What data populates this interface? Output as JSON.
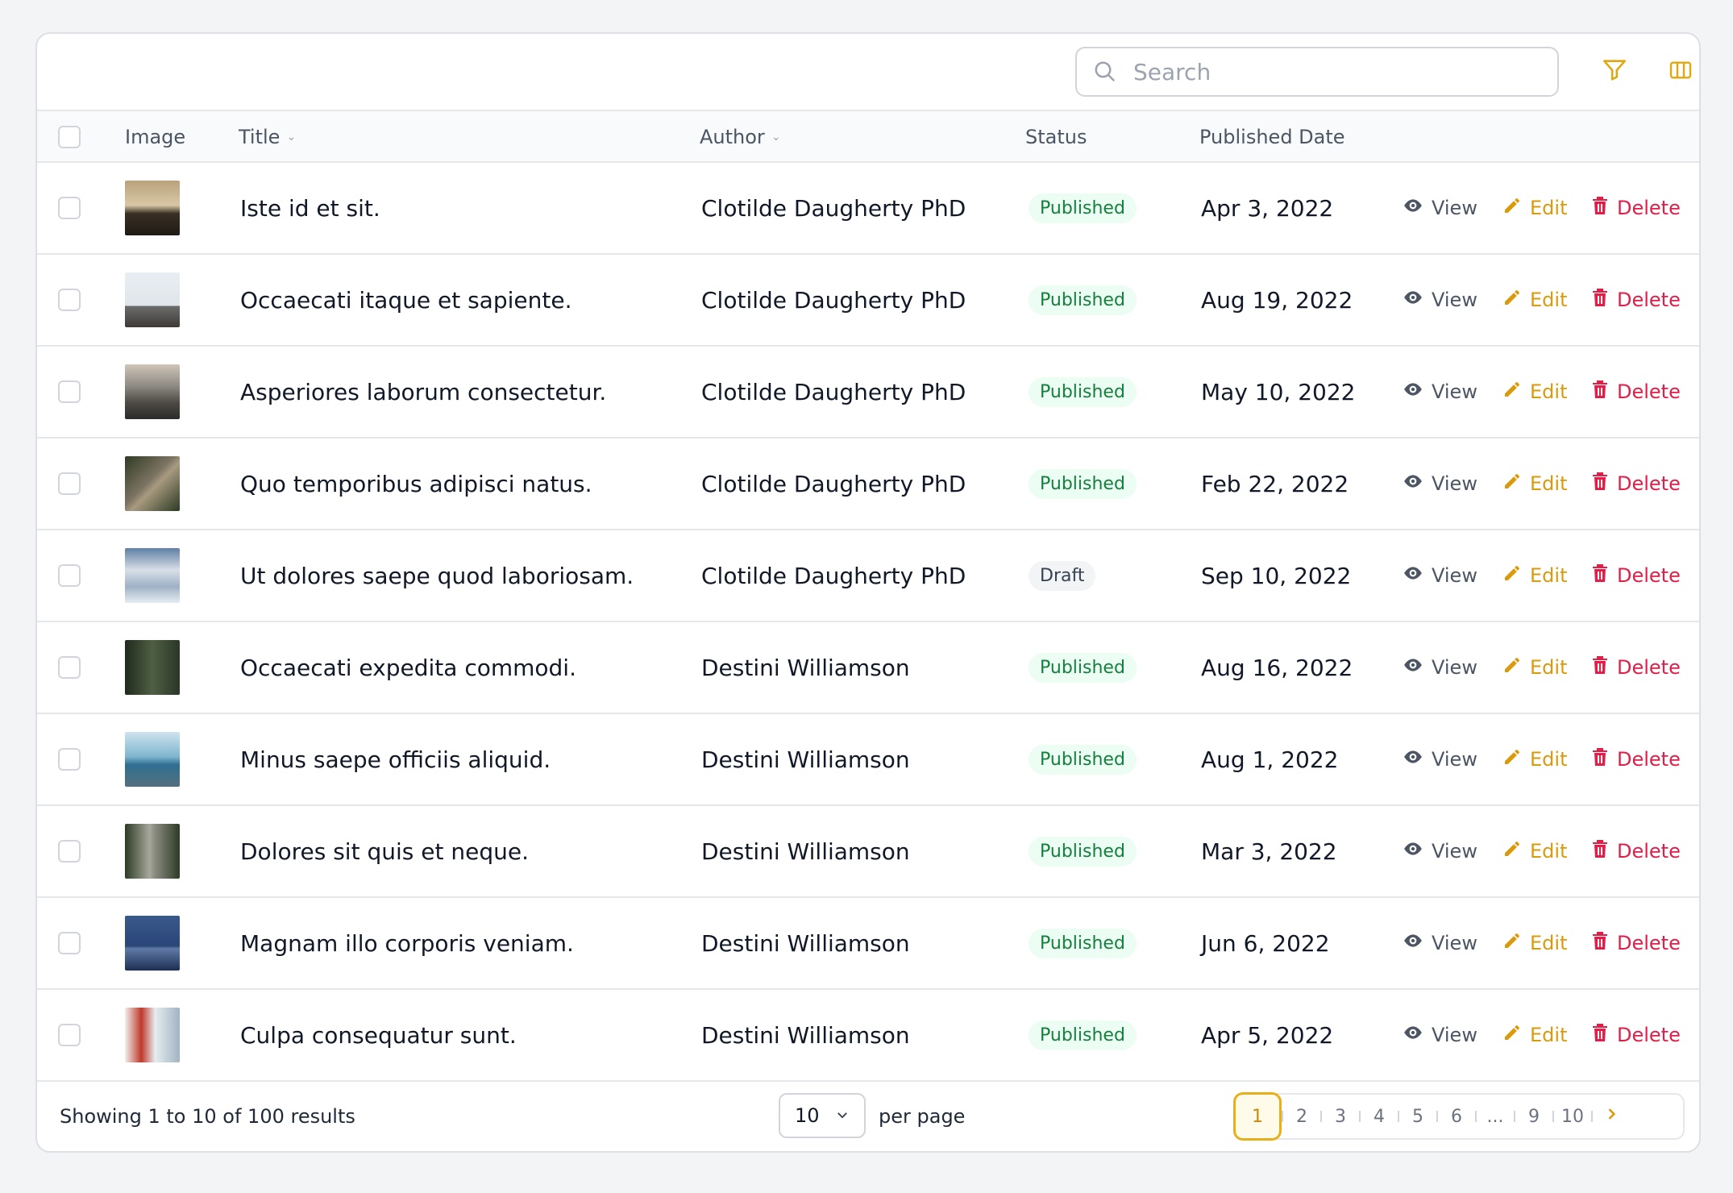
{
  "search": {
    "placeholder": "Search",
    "value": ""
  },
  "toolbar": {
    "filter_icon": "filter-icon",
    "columns_icon": "columns-icon",
    "accent": "#e0a80e"
  },
  "columns": {
    "image": "Image",
    "title": "Title",
    "author": "Author",
    "status": "Status",
    "published_date": "Published Date"
  },
  "actions": {
    "view": "View",
    "edit": "Edit",
    "delete": "Delete"
  },
  "rows": [
    {
      "title": "Iste id et sit.",
      "author": "Clotilde Daugherty PhD",
      "status": "Published",
      "date": "Apr 3, 2022"
    },
    {
      "title": "Occaecati itaque et sapiente.",
      "author": "Clotilde Daugherty PhD",
      "status": "Published",
      "date": "Aug 19, 2022"
    },
    {
      "title": "Asperiores laborum consectetur.",
      "author": "Clotilde Daugherty PhD",
      "status": "Published",
      "date": "May 10, 2022"
    },
    {
      "title": "Quo temporibus adipisci natus.",
      "author": "Clotilde Daugherty PhD",
      "status": "Published",
      "date": "Feb 22, 2022"
    },
    {
      "title": "Ut dolores saepe quod laboriosam.",
      "author": "Clotilde Daugherty PhD",
      "status": "Draft",
      "date": "Sep 10, 2022"
    },
    {
      "title": "Occaecati expedita commodi.",
      "author": "Destini Williamson",
      "status": "Published",
      "date": "Aug 16, 2022"
    },
    {
      "title": "Minus saepe officiis aliquid.",
      "author": "Destini Williamson",
      "status": "Published",
      "date": "Aug 1, 2022"
    },
    {
      "title": "Dolores sit quis et neque.",
      "author": "Destini Williamson",
      "status": "Published",
      "date": "Mar 3, 2022"
    },
    {
      "title": "Magnam illo corporis veniam.",
      "author": "Destini Williamson",
      "status": "Published",
      "date": "Jun 6, 2022"
    },
    {
      "title": "Culpa consequatur sunt.",
      "author": "Destini Williamson",
      "status": "Published",
      "date": "Apr 5, 2022"
    }
  ],
  "footer": {
    "showing": "Showing 1 to 10 of 100 results",
    "per_page_value": "10",
    "per_page_label": "per page",
    "pages": [
      "1",
      "2",
      "3",
      "4",
      "5",
      "6",
      "...",
      "9",
      "10"
    ],
    "current_page": "1"
  }
}
